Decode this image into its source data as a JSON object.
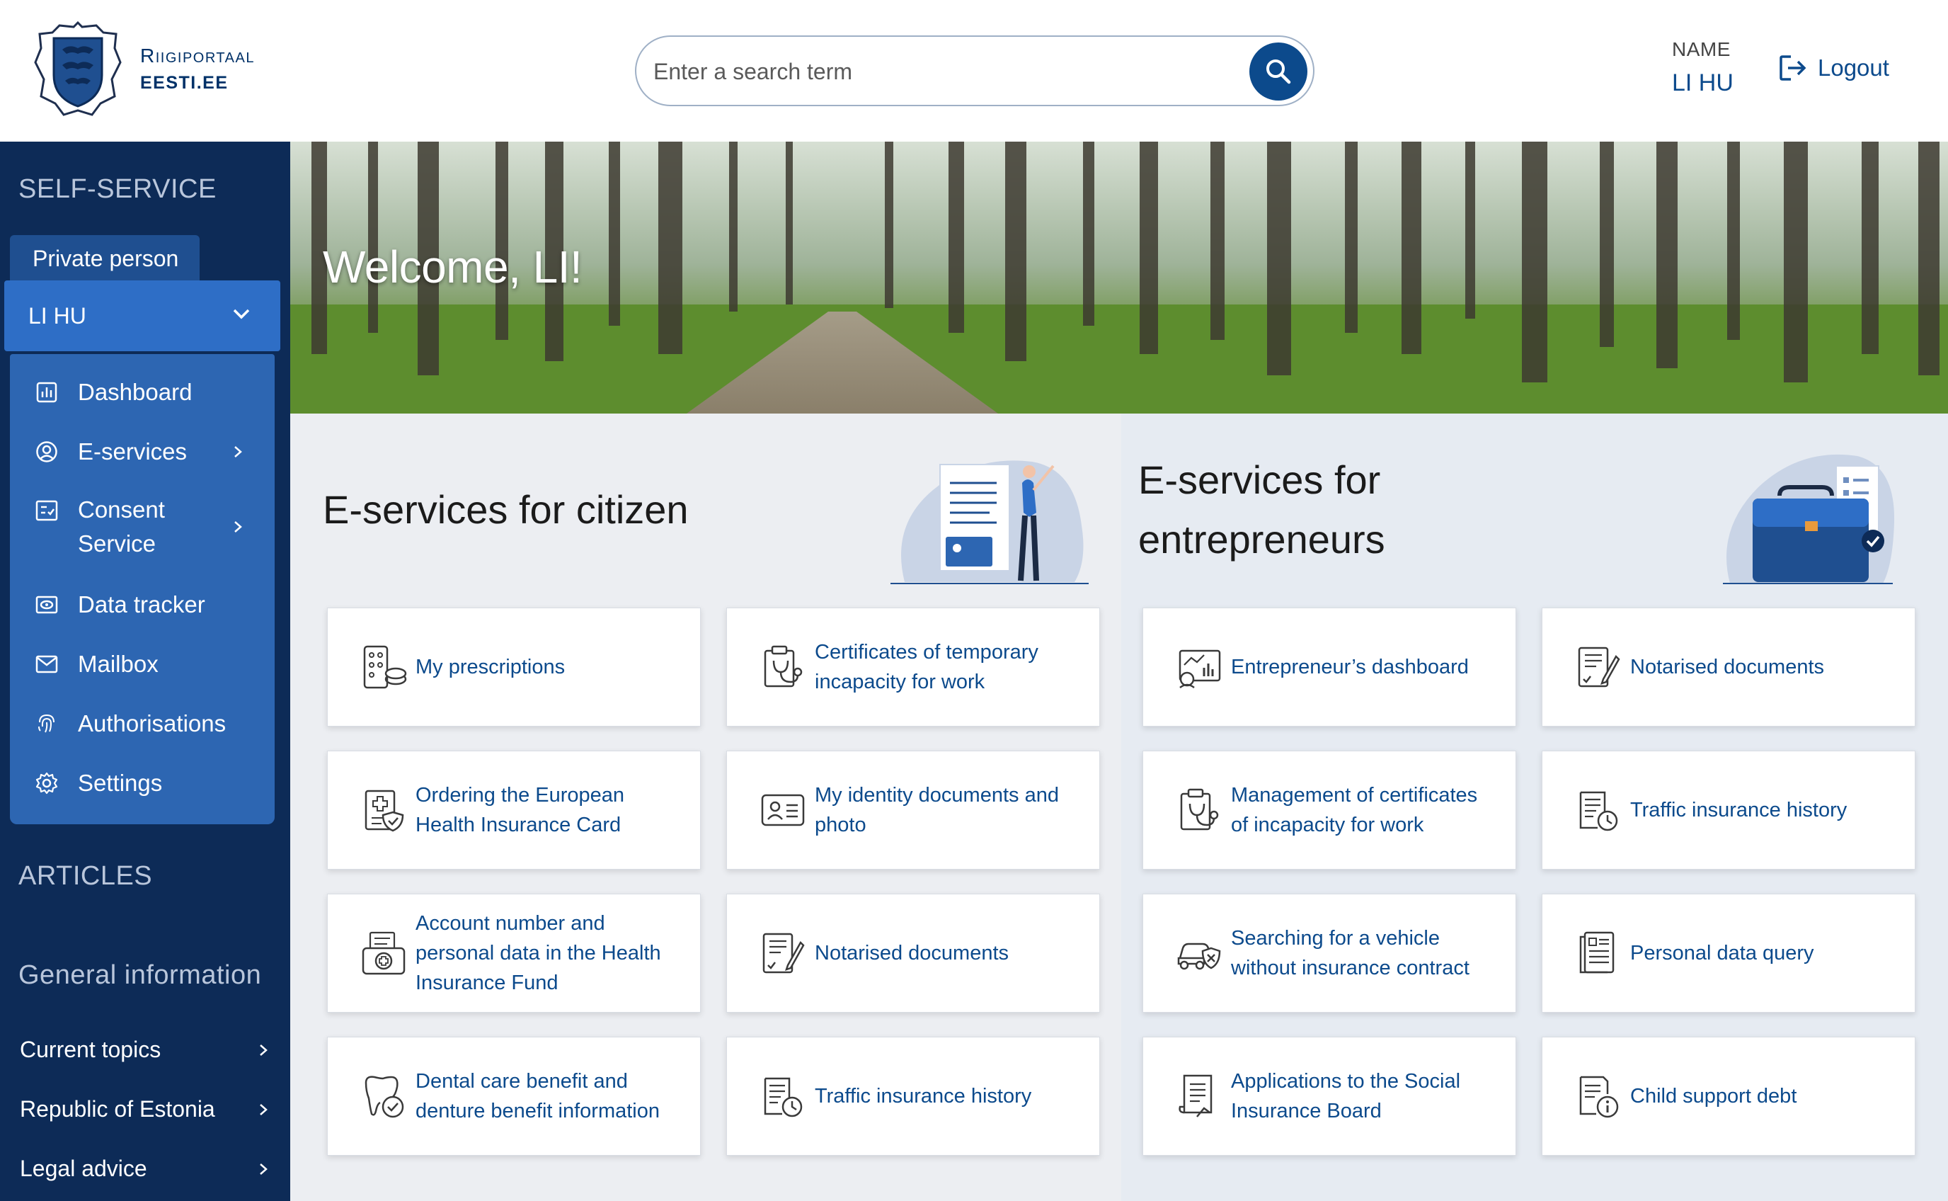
{
  "header": {
    "brand_line1": "Riigiportaal",
    "brand_line2": "EESTI.EE",
    "search_placeholder": "Enter a search term",
    "user_label": "NAME",
    "user_name": "LI HU",
    "logout_label": "Logout"
  },
  "sidebar": {
    "self_service_title": "SELF-SERVICE",
    "person_tab": "Private person",
    "person_select": "LI HU",
    "menu": [
      {
        "label": "Dashboard",
        "icon": "dashboard-icon"
      },
      {
        "label": "E-services",
        "icon": "user-circle-icon"
      },
      {
        "label_line1": "Consent",
        "label_line2": "Service",
        "icon": "consent-icon"
      },
      {
        "label": "Data tracker",
        "icon": "data-tracker-icon"
      },
      {
        "label": "Mailbox",
        "icon": "mail-icon"
      },
      {
        "label": "Authorisations",
        "icon": "fingerprint-icon"
      },
      {
        "label": "Settings",
        "icon": "gear-icon"
      }
    ],
    "articles_title": "ARTICLES",
    "general_info_title": "General information",
    "articles": [
      {
        "label": "Current topics"
      },
      {
        "label": "Republic of Estonia"
      },
      {
        "label": "Legal advice"
      }
    ]
  },
  "hero": {
    "welcome": "Welcome, LI!"
  },
  "citizen": {
    "title": "E-services for citizen",
    "cards": [
      {
        "line1": "My prescriptions",
        "line2": "",
        "line3": "",
        "icon": "prescription-icon"
      },
      {
        "line1": "Certificates of temporary",
        "line2": "incapacity for work",
        "line3": "",
        "icon": "clipboard-stethoscope-icon"
      },
      {
        "line1": "Ordering the European",
        "line2": "Health Insurance Card",
        "line3": "",
        "icon": "health-card-icon"
      },
      {
        "line1": "My identity documents and",
        "line2": "photo",
        "line3": "",
        "icon": "id-card-icon"
      },
      {
        "line1": "Account number and",
        "line2": "personal data in the Health",
        "line3": "Insurance Fund",
        "icon": "medical-bag-icon"
      },
      {
        "line1": "Notarised documents",
        "line2": "",
        "line3": "",
        "icon": "signed-document-icon"
      },
      {
        "line1": "Dental care benefit and",
        "line2": "denture benefit information",
        "line3": "",
        "icon": "tooth-icon"
      },
      {
        "line1": "Traffic insurance history",
        "line2": "",
        "line3": "",
        "icon": "document-clock-icon"
      }
    ]
  },
  "entrepreneur": {
    "title_line1": "E-services for",
    "title_line2": "entrepreneurs",
    "cards": [
      {
        "line1": "Entrepreneur’s dashboard",
        "line2": "",
        "icon": "dashboard-chart-icon"
      },
      {
        "line1": "Notarised documents",
        "line2": "",
        "icon": "signed-document-icon"
      },
      {
        "line1": "Management of certificates",
        "line2": "of incapacity for work",
        "icon": "clipboard-stethoscope-icon"
      },
      {
        "line1": "Traffic insurance history",
        "line2": "",
        "icon": "document-clock-icon"
      },
      {
        "line1": "Searching for a vehicle",
        "line2": "without insurance contract",
        "icon": "car-shield-icon"
      },
      {
        "line1": "Personal data query",
        "line2": "",
        "icon": "data-query-icon"
      },
      {
        "line1": "Applications to the Social",
        "line2": "Insurance Board",
        "icon": "application-document-icon"
      },
      {
        "line1": "Child support debt",
        "line2": "",
        "icon": "document-info-icon"
      }
    ]
  },
  "colors": {
    "brand_dark": "#0d2b57",
    "brand_blue": "#0c4a8c",
    "menu_panel": "#2d66b2",
    "select_bg": "#2e6ec6"
  }
}
